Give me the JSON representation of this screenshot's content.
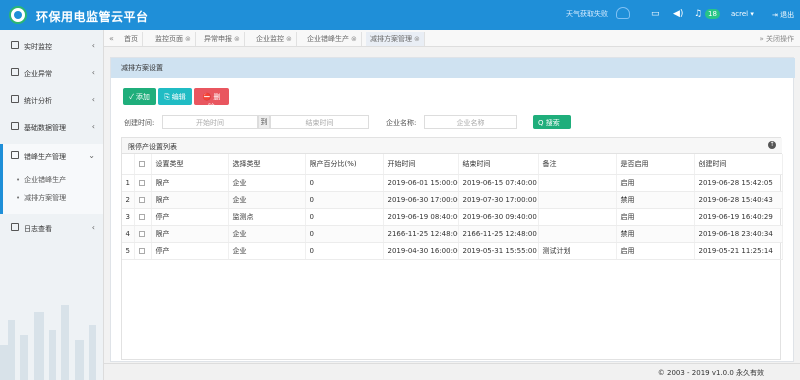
{
  "app": {
    "title": "环保用电监管云平台",
    "weather": "天气获取失败",
    "notifications": "18",
    "user": "acrel",
    "logout": "退出",
    "colors": {
      "primary": "#1f8fd8",
      "success": "#1fae7b",
      "info": "#20bcc4",
      "danger": "#e9565f"
    }
  },
  "sidebar": {
    "items": [
      {
        "label": "实时监控",
        "icon": "monitor-icon"
      },
      {
        "label": "企业异常",
        "icon": "warning-icon"
      },
      {
        "label": "统计分析",
        "icon": "chart-icon"
      },
      {
        "label": "基础数据管理",
        "icon": "database-icon"
      },
      {
        "label": "错峰生产管理",
        "icon": "calendar-icon"
      },
      {
        "label": "日志查看",
        "icon": "log-icon"
      }
    ],
    "subitems": [
      "企业错峰生产",
      "减排方案管理"
    ]
  },
  "tabs": [
    {
      "label": "首页"
    },
    {
      "label": "监控页面"
    },
    {
      "label": "异常申报"
    },
    {
      "label": "企业监控"
    },
    {
      "label": "企业错峰生产"
    },
    {
      "label": "减排方案管理"
    }
  ],
  "tabs_right": "关闭操作",
  "panel": {
    "title": "减排方案设置",
    "buttons": {
      "add": "✓ 添加",
      "edit": "⎘ 编辑",
      "delete": "⛔ 删除"
    },
    "filters": {
      "created_label": "创建时间:",
      "start_placeholder": "开始时间",
      "to": "到",
      "end_placeholder": "结束时间",
      "company_label": "企业名称:",
      "company_placeholder": "企业名称",
      "search": "Q 搜索"
    },
    "list_title": "限停产设置列表",
    "columns": [
      "",
      "设置类型",
      "选择类型",
      "限产百分比(%)",
      "开始时间",
      "结束时间",
      "备注",
      "是否启用",
      "创建时间"
    ],
    "rows": [
      [
        "1",
        "限产",
        "企业",
        "0",
        "2019-06-01 15:00:00",
        "2019-06-15 07:40:00",
        "",
        "启用",
        "2019-06-28 15:42:05"
      ],
      [
        "2",
        "限产",
        "企业",
        "0",
        "2019-06-30 17:00:00",
        "2019-07-30 17:00:00",
        "",
        "禁用",
        "2019-06-28 15:40:43"
      ],
      [
        "3",
        "停产",
        "监测点",
        "0",
        "2019-06-19 08:40:00",
        "2019-06-30 09:40:00",
        "",
        "启用",
        "2019-06-19 16:40:29"
      ],
      [
        "4",
        "限产",
        "企业",
        "0",
        "2166-11-25 12:48:00",
        "2166-11-25 12:48:00",
        "",
        "禁用",
        "2019-06-18 23:40:34"
      ],
      [
        "5",
        "停产",
        "企业",
        "0",
        "2019-04-30 16:00:00",
        "2019-05-31 15:55:00",
        "测试计划",
        "启用",
        "2019-05-21 11:25:14"
      ]
    ]
  },
  "footer": "© 2003 - 2019 v1.0.0 永久有效"
}
